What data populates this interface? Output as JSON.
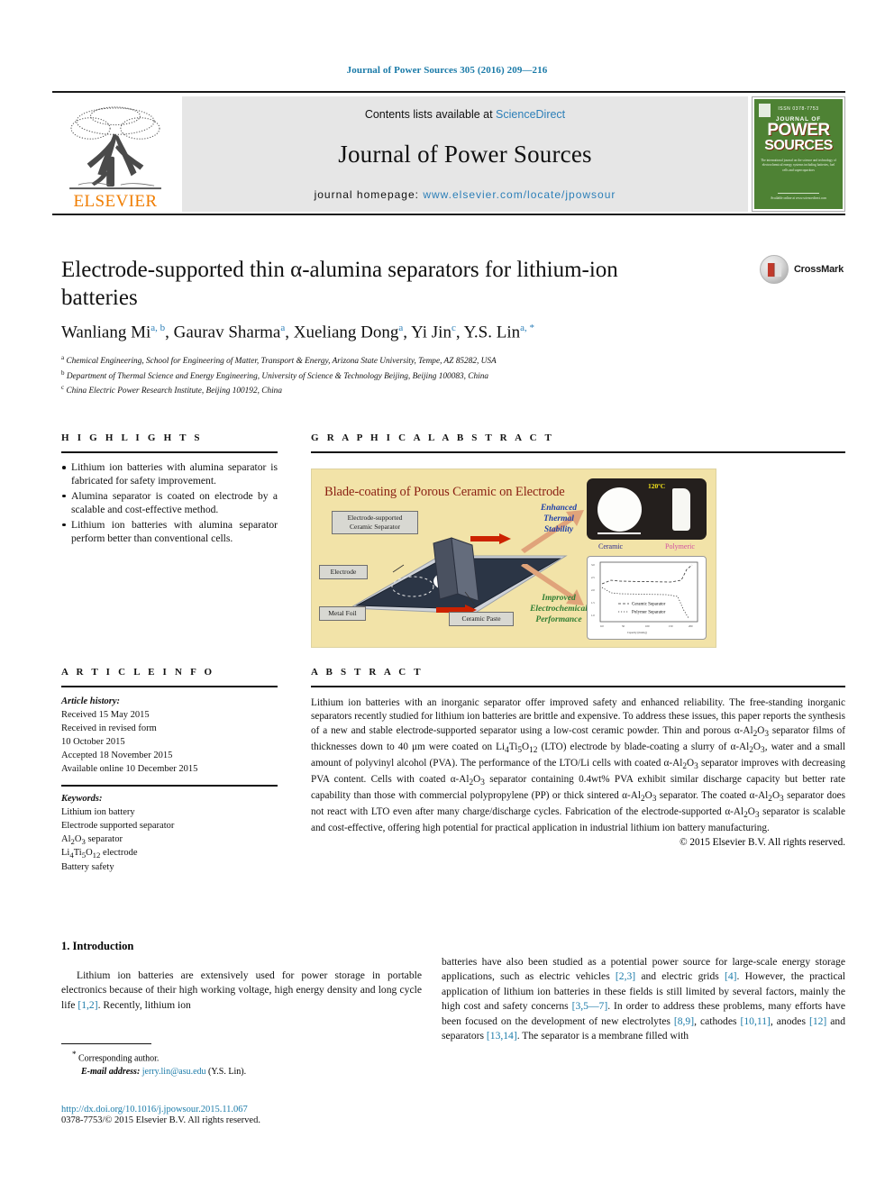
{
  "running_head": "Journal of Power Sources 305 (2016) 209—216",
  "masthead": {
    "contents_prefix": "Contents lists available at ",
    "sciencedirect": "ScienceDirect",
    "journal_title": "Journal of Power Sources",
    "homepage_prefix": "journal homepage: ",
    "homepage_url": "www.elsevier.com/locate/jpowsour",
    "publisher": "ELSEVIER",
    "cover": {
      "top_label": "ISSN 0378-7753",
      "journal_of": "JOURNAL OF",
      "power": "POWER",
      "sources": "SOURCES",
      "blurb": "The international journal on the science and technology of electrochemical energy systems including batteries, fuel cells and supercapacitors",
      "bottom": "Available online at www.sciencedirect.com"
    }
  },
  "crossmark": {
    "label": "CrossMark"
  },
  "article": {
    "title": "Electrode-supported thin α-alumina separators for lithium-ion batteries",
    "authors": [
      {
        "name": "Wanliang Mi",
        "marks": "a, b"
      },
      {
        "name": "Gaurav Sharma",
        "marks": "a"
      },
      {
        "name": "Xueliang Dong",
        "marks": "a"
      },
      {
        "name": "Yi Jin",
        "marks": "c"
      },
      {
        "name": "Y.S. Lin",
        "marks": "a, *"
      }
    ],
    "affiliations": [
      {
        "mark": "a",
        "text": "Chemical Engineering, School for Engineering of Matter, Transport & Energy, Arizona State University, Tempe, AZ 85282, USA"
      },
      {
        "mark": "b",
        "text": "Department of Thermal Science and Energy Engineering, University of Science & Technology Beijing, Beijing 100083, China"
      },
      {
        "mark": "c",
        "text": "China Electric Power Research Institute, Beijing 100192, China"
      }
    ]
  },
  "highlights": {
    "heading": "H I G H L I G H T S",
    "items": [
      "Lithium ion batteries with alumina separator is fabricated for safety improvement.",
      "Alumina separator is coated on electrode by a scalable and cost-effective method.",
      "Lithium ion batteries with alumina separator perform better than conventional cells."
    ]
  },
  "graphical_abstract": {
    "heading": "G R A P H I C A L  A B S T R A C T",
    "figure": {
      "title": "Blade-coating of Porous Ceramic on Electrode",
      "label_separator": "Electrode-supported\nCeramic Separator",
      "label_electrode": "Electrode",
      "label_metal_foil": "Metal Foil",
      "label_ceramic_paste": "Ceramic Paste",
      "label_thermal": "Enhanced\nThermal\nStability",
      "label_electrochem": "Improved\nElectrochemical\nPerformance",
      "photo_temp": "120ºC",
      "photo_caption_ceramic": "Ceramic",
      "photo_caption_polymeric": "Polymeric",
      "chart_legend_1": "Ceramic Separator",
      "chart_legend_2": "Polymer Separator"
    }
  },
  "article_info": {
    "heading": "A R T I C L E  I N F O",
    "history_label": "Article history:",
    "history": [
      "Received 15 May 2015",
      "Received in revised form",
      "10 October 2015",
      "Accepted 18 November 2015",
      "Available online 10 December 2015"
    ],
    "keywords_label": "Keywords:",
    "keywords": [
      "Lithium ion battery",
      "Electrode supported separator",
      "Al2O3 separator",
      "Li4Ti5O12 electrode",
      "Battery safety"
    ]
  },
  "abstract": {
    "heading": "A B S T R A C T",
    "text": "Lithium ion batteries with an inorganic separator offer improved safety and enhanced reliability. The free-standing inorganic separators recently studied for lithium ion batteries are brittle and expensive. To address these issues, this paper reports the synthesis of a new and stable electrode-supported separator using a low-cost ceramic powder. Thin and porous α-Al2O3 separator films of thicknesses down to 40 μm were coated on Li4Ti5O12 (LTO) electrode by blade-coating a slurry of α-Al2O3, water and a small amount of polyvinyl alcohol (PVA). The performance of the LTO/Li cells with coated α-Al2O3 separator improves with decreasing PVA content. Cells with coated α-Al2O3 separator containing 0.4wt% PVA exhibit similar discharge capacity but better rate capability than those with commercial polypropylene (PP) or thick sintered α-Al2O3 separator. The coated α-Al2O3 separator does not react with LTO even after many charge/discharge cycles. Fabrication of the electrode-supported α-Al2O3 separator is scalable and cost-effective, offering high potential for practical application in industrial lithium ion battery manufacturing.",
    "copyright": "© 2015 Elsevier B.V. All rights reserved."
  },
  "introduction": {
    "heading": "1.  Introduction",
    "paragraph_left": "Lithium ion batteries are extensively used for power storage in portable electronics because of their high working voltage, high energy density and long cycle life [1,2]. Recently, lithium ion",
    "paragraph_right": "batteries have also been studied as a potential power source for large-scale energy storage applications, such as electric vehicles [2,3] and electric grids [4]. However, the practical application of lithium ion batteries in these fields is still limited by several factors, mainly the high cost and safety concerns [3,5—7]. In order to address these problems, many efforts have been focused on the development of new electrolytes [8,9], cathodes [10,11], anodes [12] and separators [13,14]. The separator is a membrane filled with"
  },
  "footnote": {
    "corresponding": "Corresponding author.",
    "email_label": "E-mail address:",
    "email": "jerry.lin@asu.edu",
    "email_owner": "(Y.S. Lin).",
    "doi": "http://dx.doi.org/10.1016/j.jpowsour.2015.11.067",
    "issn": "0378-7753/© 2015 Elsevier B.V. All rights reserved."
  },
  "colors": {
    "link": "#1a7aa8",
    "elsevier_orange": "#f07d00",
    "ga_background": "#f2e3a8",
    "ga_title": "#8a1f12",
    "cover_green": "#4e8234"
  }
}
